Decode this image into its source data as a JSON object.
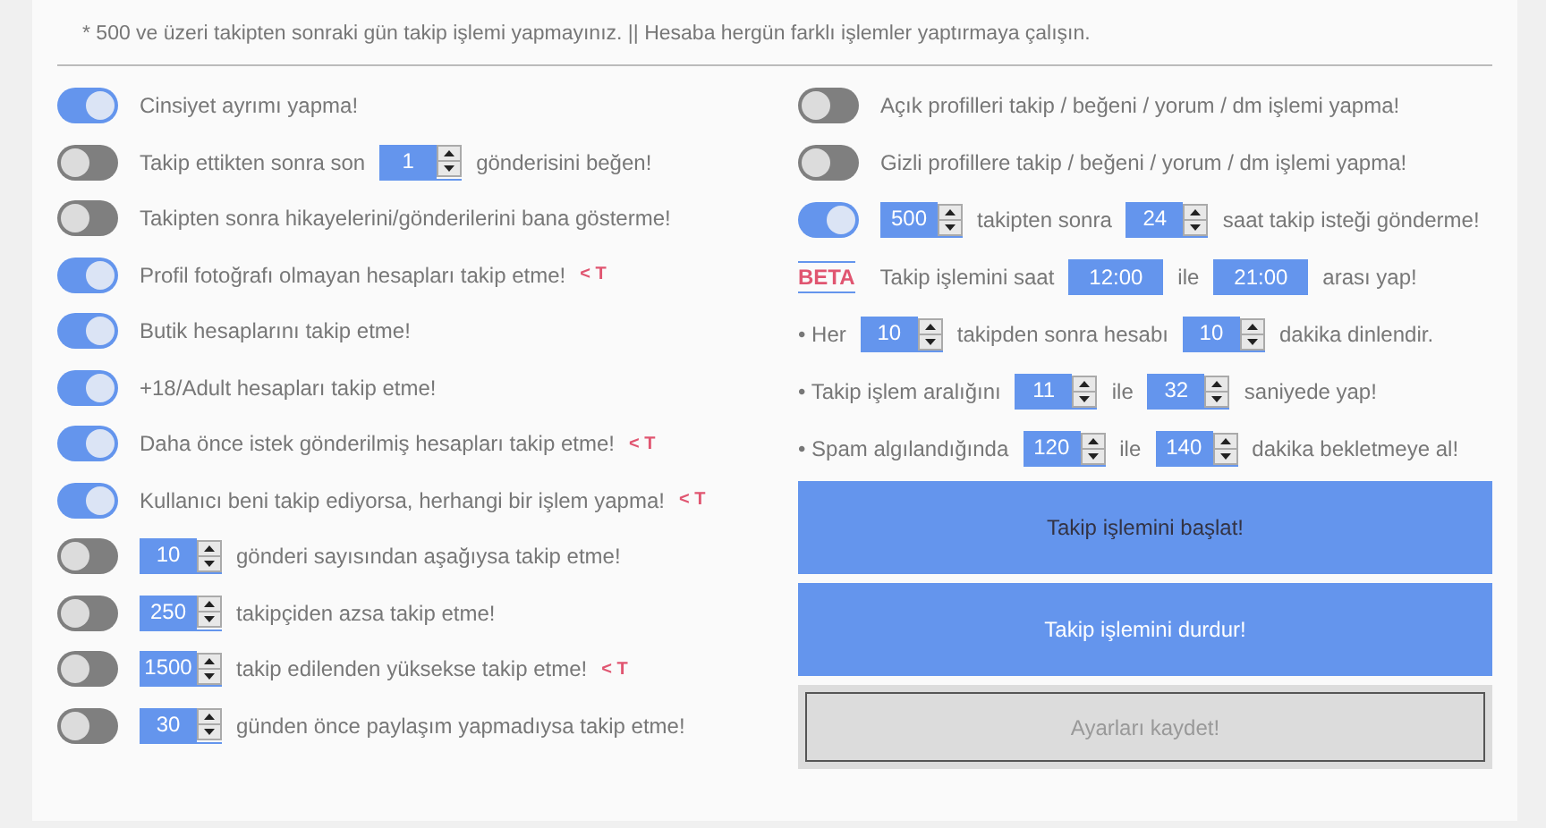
{
  "note": "* 500 ve üzeri takipten sonraki gün takip işlemi yapmayınız. || Hesaba hergün farklı işlemler yaptırmaya çalışın.",
  "left_rows": [
    {
      "kind": "toggle",
      "on": true,
      "parts": [
        {
          "kind": "text",
          "text": "Cinsiyet ayrımı yapma!"
        }
      ]
    },
    {
      "kind": "toggle",
      "on": false,
      "parts": [
        {
          "kind": "text",
          "text": "Takip ettikten sonra son"
        },
        {
          "kind": "number",
          "value": "1"
        },
        {
          "kind": "text",
          "text": "gönderisini beğen!"
        }
      ]
    },
    {
      "kind": "toggle",
      "on": false,
      "parts": [
        {
          "kind": "text",
          "text": "Takipten sonra hikayelerini/gönderilerini bana gösterme!"
        }
      ]
    },
    {
      "kind": "toggle",
      "on": true,
      "parts": [
        {
          "kind": "text",
          "text": "Profil fotoğrafı olmayan hesapları takip etme!"
        },
        {
          "kind": "tag",
          "text": "< T"
        }
      ]
    },
    {
      "kind": "toggle",
      "on": true,
      "parts": [
        {
          "kind": "text",
          "text": "Butik hesaplarını takip etme!"
        }
      ]
    },
    {
      "kind": "toggle",
      "on": true,
      "parts": [
        {
          "kind": "text",
          "text": "+18/Adult hesapları takip etme!"
        }
      ]
    },
    {
      "kind": "toggle",
      "on": true,
      "parts": [
        {
          "kind": "text",
          "text": "Daha önce istek gönderilmiş hesapları takip etme!"
        },
        {
          "kind": "tag",
          "text": "< T"
        }
      ]
    },
    {
      "kind": "toggle",
      "on": true,
      "parts": [
        {
          "kind": "text",
          "text": "Kullanıcı beni takip ediyorsa, herhangi bir işlem yapma!"
        },
        {
          "kind": "tag",
          "text": "< T"
        }
      ]
    },
    {
      "kind": "toggle",
      "on": false,
      "parts": [
        {
          "kind": "number",
          "value": "10"
        },
        {
          "kind": "text",
          "text": "gönderi sayısından aşağıysa takip etme!"
        }
      ]
    },
    {
      "kind": "toggle",
      "on": false,
      "parts": [
        {
          "kind": "number",
          "value": "250"
        },
        {
          "kind": "text",
          "text": "takipçiden azsa takip etme!"
        }
      ]
    },
    {
      "kind": "toggle",
      "on": false,
      "parts": [
        {
          "kind": "number",
          "value": "1500"
        },
        {
          "kind": "text",
          "text": "takip edilenden yüksekse takip etme!"
        },
        {
          "kind": "tag",
          "text": "< T"
        }
      ]
    },
    {
      "kind": "toggle",
      "on": false,
      "parts": [
        {
          "kind": "number",
          "value": "30"
        },
        {
          "kind": "text",
          "text": "günden önce paylaşım yapmadıysa takip etme!"
        }
      ]
    }
  ],
  "right_rows": [
    {
      "kind": "toggle",
      "on": false,
      "parts": [
        {
          "kind": "text",
          "text": "Açık profilleri takip / beğeni / yorum / dm işlemi yapma!"
        }
      ]
    },
    {
      "kind": "toggle",
      "on": false,
      "parts": [
        {
          "kind": "text",
          "text": "Gizli profillere takip / beğeni / yorum / dm işlemi yapma!"
        }
      ]
    },
    {
      "kind": "toggle",
      "on": true,
      "parts": [
        {
          "kind": "number",
          "value": "500"
        },
        {
          "kind": "text",
          "text": "takipten sonra"
        },
        {
          "kind": "number",
          "value": "24"
        },
        {
          "kind": "text",
          "text": "saat takip isteği gönderme!"
        }
      ]
    },
    {
      "kind": "badge",
      "badge": "BETA",
      "parts": [
        {
          "kind": "text",
          "text": "Takip işlemini saat"
        },
        {
          "kind": "time",
          "value": "12:00"
        },
        {
          "kind": "text",
          "text": "ile"
        },
        {
          "kind": "time",
          "value": "21:00"
        },
        {
          "kind": "text",
          "text": "arası yap!"
        }
      ]
    },
    {
      "kind": "bullet",
      "parts": [
        {
          "kind": "text",
          "text": "• Her"
        },
        {
          "kind": "number",
          "value": "10"
        },
        {
          "kind": "text",
          "text": "takipden sonra hesabı"
        },
        {
          "kind": "number",
          "value": "10"
        },
        {
          "kind": "text",
          "text": "dakika dinlendir."
        }
      ]
    },
    {
      "kind": "bullet",
      "parts": [
        {
          "kind": "text",
          "text": "• Takip işlem aralığını"
        },
        {
          "kind": "number",
          "value": "11"
        },
        {
          "kind": "text",
          "text": "ile"
        },
        {
          "kind": "number",
          "value": "32"
        },
        {
          "kind": "text",
          "text": "saniyede yap!"
        }
      ]
    },
    {
      "kind": "bullet",
      "parts": [
        {
          "kind": "text",
          "text": "• Spam algılandığında"
        },
        {
          "kind": "number",
          "value": "120"
        },
        {
          "kind": "text",
          "text": "ile"
        },
        {
          "kind": "number",
          "value": "140"
        },
        {
          "kind": "text",
          "text": "dakika bekletmeye al!"
        }
      ]
    }
  ],
  "buttons": [
    {
      "kind": "start",
      "label": "Takip işlemini başlat!"
    },
    {
      "kind": "stop",
      "label": "Takip işlemini durdur!"
    },
    {
      "kind": "save",
      "label": "Ayarları kaydet!"
    }
  ]
}
